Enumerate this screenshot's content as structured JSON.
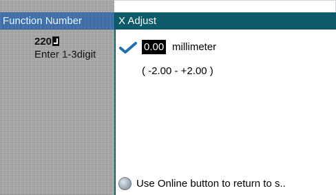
{
  "left_panel": {
    "header": "Function Number",
    "value": "220",
    "hint": "Enter 1-3digit"
  },
  "right_panel": {
    "title": "X Adjust",
    "value": "0.00",
    "unit": "millimeter",
    "range": "( -2.00 - +2.00 )",
    "status_text": "Use Online button to return to s.."
  },
  "colors": {
    "accent_teal": "#0d5b6a",
    "left_header_blue": "#1f5ea8",
    "check_blue": "#1e6fb8"
  },
  "icons": {
    "check": "checkmark-icon",
    "status": "online-indicator-icon",
    "enter": "enter-key-icon"
  }
}
